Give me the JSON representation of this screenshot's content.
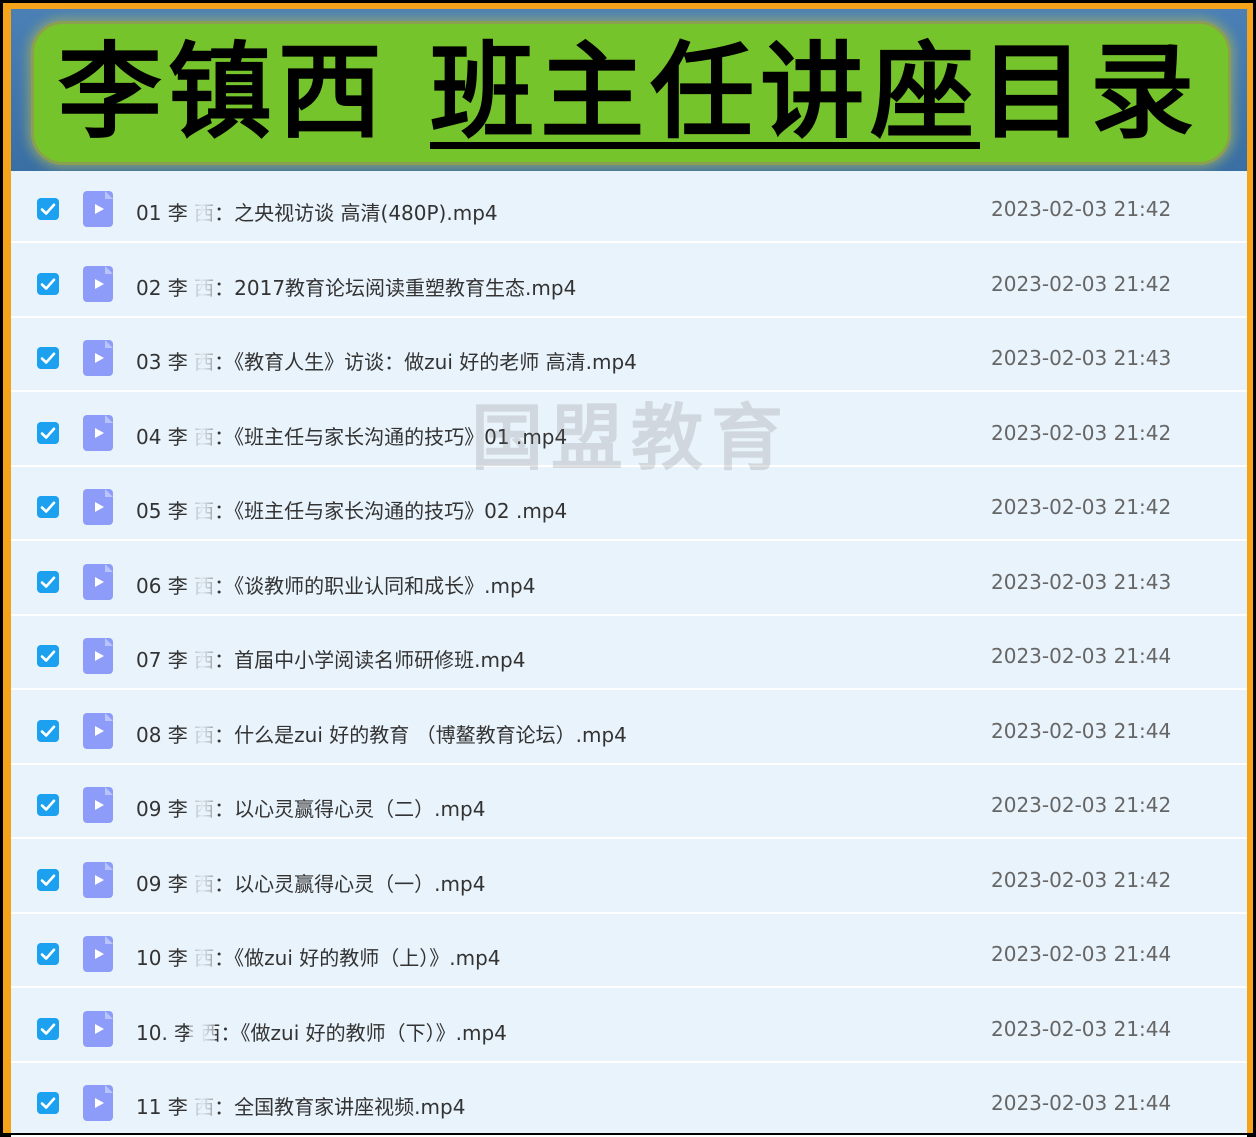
{
  "banner": {
    "title_part1": "李镇西 ",
    "title_part2": "班主任讲座",
    "title_part3": "目录"
  },
  "watermark": "国盟教育",
  "files": [
    {
      "name": "01  李   西：之央视访谈 高清(480P).mp4",
      "date": "2023-02-03 21:42",
      "checked": true
    },
    {
      "name": "02 李   西：2017教育论坛阅读重塑教育生态.mp4",
      "date": "2023-02-03 21:42",
      "checked": true
    },
    {
      "name": "03 李   西：《教育人生》访谈：做zui 好的老师 高清.mp4",
      "date": "2023-02-03 21:43",
      "checked": true
    },
    {
      "name": "04 李   西：《班主任与家长沟通的技巧》01 .mp4",
      "date": "2023-02-03 21:42",
      "checked": true
    },
    {
      "name": "05 李   西：《班主任与家长沟通的技巧》02 .mp4",
      "date": "2023-02-03 21:42",
      "checked": true
    },
    {
      "name": "06 李   西：《谈教师的职业认同和成长》.mp4",
      "date": "2023-02-03 21:43",
      "checked": true
    },
    {
      "name": "07 李   西：首届中小学阅读名师研修班.mp4",
      "date": "2023-02-03 21:44",
      "checked": true
    },
    {
      "name": "08 李   西：什么是zui 好的教育 （博鳌教育论坛）.mp4",
      "date": "2023-02-03 21:44",
      "checked": true
    },
    {
      "name": "09 李   西：以心灵赢得心灵（二）.mp4",
      "date": "2023-02-03 21:42",
      "checked": true
    },
    {
      "name": "09 李   西：以心灵赢得心灵（一）.mp4",
      "date": "2023-02-03 21:42",
      "checked": true
    },
    {
      "name": "10 李   西：《做zui 好的教师（上）》.mp4",
      "date": "2023-02-03 21:44",
      "checked": true
    },
    {
      "name": "10. 李   西：《做zui 好的教师（下）》.mp4",
      "date": "2023-02-03 21:44",
      "checked": true
    },
    {
      "name": "11 李   西：全国教育家讲座视频.mp4",
      "date": "2023-02-03 21:44",
      "checked": true
    }
  ]
}
